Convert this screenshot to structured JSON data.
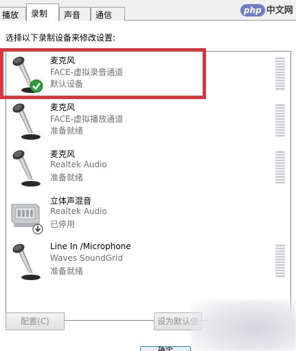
{
  "tabs": [
    {
      "label": "播放",
      "active": false
    },
    {
      "label": "录制",
      "active": true
    },
    {
      "label": "声音",
      "active": false
    },
    {
      "label": "通信",
      "active": false
    }
  ],
  "logo": {
    "php": "php",
    "cn": "中文网"
  },
  "instruction": "选择以下录制设备来修改设置:",
  "devices": [
    {
      "name": "麦克风",
      "source": "FACE-虚拟录音通道",
      "status": "默认设备",
      "icon": "microphone-icon",
      "badge": "check-icon",
      "selected": true
    },
    {
      "name": "麦克风",
      "source": "FACE-虚拟播放通道",
      "status": "准备就绪",
      "icon": "microphone-icon"
    },
    {
      "name": "麦克风",
      "source": "Realtek Audio",
      "status": "准备就绪",
      "icon": "microphone-icon"
    },
    {
      "name": "立体声混音",
      "source": "Realtek Audio",
      "status": "已停用",
      "icon": "sound-card-icon",
      "badge": "disabled-arrow-icon"
    },
    {
      "name": "Line In /Microphone",
      "source": "Waves SoundGrid",
      "status": "准备就绪",
      "icon": "microphone-icon"
    }
  ],
  "buttons": {
    "configure": "配置(C)",
    "set_default": "设为默认值",
    "ok": "确定"
  },
  "colors": {
    "highlight": "#d9363e",
    "check": "#2e9e3b"
  }
}
